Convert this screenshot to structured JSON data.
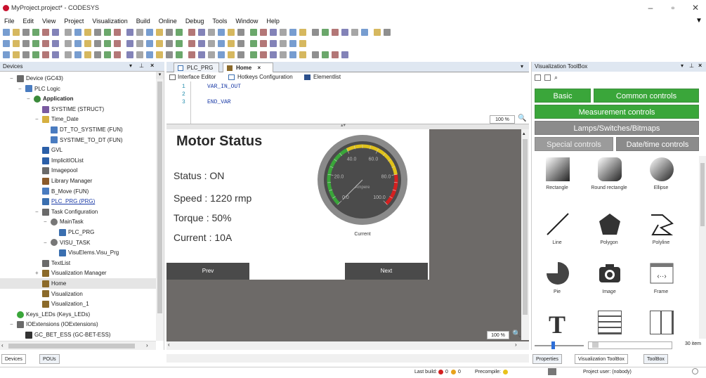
{
  "window": {
    "title": "MyProject.project* - CODESYS"
  },
  "menu": [
    "File",
    "Edit",
    "View",
    "Project",
    "Visualization",
    "Build",
    "Online",
    "Debug",
    "Tools",
    "Window",
    "Help"
  ],
  "devices_panel": {
    "title": "Devices",
    "tree": [
      {
        "label": "Device (GC43)",
        "depth": 1,
        "expand": "−",
        "icon": "device"
      },
      {
        "label": "PLC Logic",
        "depth": 2,
        "expand": "−",
        "icon": "plc"
      },
      {
        "label": "Application",
        "depth": 3,
        "expand": "−",
        "icon": "app",
        "bold": true
      },
      {
        "label": "SYSTIME (STRUCT)",
        "depth": 4,
        "expand": "",
        "icon": "struct"
      },
      {
        "label": "Time_Date",
        "depth": 4,
        "expand": "−",
        "icon": "folder"
      },
      {
        "label": "DT_TO_SYSTIME (FUN)",
        "depth": 5,
        "expand": "",
        "icon": "fun"
      },
      {
        "label": "SYSTIME_TO_DT (FUN)",
        "depth": 5,
        "expand": "",
        "icon": "fun"
      },
      {
        "label": "GVL",
        "depth": 4,
        "expand": "",
        "icon": "gvl"
      },
      {
        "label": "ImplicitIOList",
        "depth": 4,
        "expand": "",
        "icon": "gvl"
      },
      {
        "label": "Imagepool",
        "depth": 4,
        "expand": "",
        "icon": "image"
      },
      {
        "label": "Library Manager",
        "depth": 4,
        "expand": "",
        "icon": "lib"
      },
      {
        "label": "B_Move (FUN)",
        "depth": 4,
        "expand": "",
        "icon": "fun"
      },
      {
        "label": "PLC_PRG (PRG)",
        "depth": 4,
        "expand": "",
        "icon": "prg",
        "link": true
      },
      {
        "label": "Task Configuration",
        "depth": 4,
        "expand": "−",
        "icon": "task"
      },
      {
        "label": "MainTask",
        "depth": 5,
        "expand": "−",
        "icon": "gear"
      },
      {
        "label": "PLC_PRG",
        "depth": 6,
        "expand": "",
        "icon": "prg"
      },
      {
        "label": "VISU_TASK",
        "depth": 5,
        "expand": "−",
        "icon": "gear"
      },
      {
        "label": "VisuElems.Visu_Prg",
        "depth": 6,
        "expand": "",
        "icon": "prg"
      },
      {
        "label": "TextList",
        "depth": 4,
        "expand": "",
        "icon": "textlist"
      },
      {
        "label": "Visualization Manager",
        "depth": 4,
        "expand": "+",
        "icon": "vismgr"
      },
      {
        "label": "Home",
        "depth": 4,
        "expand": "",
        "icon": "visu",
        "selected": true
      },
      {
        "label": "Visualization",
        "depth": 4,
        "expand": "",
        "icon": "visu"
      },
      {
        "label": "Visualization_1",
        "depth": 4,
        "expand": "",
        "icon": "visu"
      },
      {
        "label": "Keys_LEDs (Keys_LEDs)",
        "depth": 1,
        "expand": "",
        "icon": "keys"
      },
      {
        "label": "IOExtensions (IOExtensions)",
        "depth": 1,
        "expand": "−",
        "icon": "io"
      },
      {
        "label": "GC_BET_ESS (GC-BET-ESS)",
        "depth": 2,
        "expand": "",
        "icon": "module"
      }
    ],
    "bottom_tabs": [
      "Devices",
      "POUs"
    ]
  },
  "editor": {
    "tabs": [
      {
        "label": "PLC_PRG",
        "active": false
      },
      {
        "label": "Home",
        "active": true
      }
    ],
    "subtabs": [
      "Interface Editor",
      "Hotkeys Configuration",
      "Elementlist"
    ],
    "code": [
      {
        "n": "1",
        "text": "VAR_IN_OUT"
      },
      {
        "n": "2",
        "text": ""
      },
      {
        "n": "3",
        "text": "END_VAR"
      }
    ],
    "zoom_top": "100 %",
    "zoom_bottom": "100 %"
  },
  "visu": {
    "title": "Motor Status",
    "status": "Status : ON",
    "speed": "Speed : 1220 rmp",
    "torque": "Torque : 50%",
    "current": "Current : 10A",
    "gauge": {
      "unit": "Ampere",
      "label": "Current",
      "ticks": [
        "0.0",
        "20.0",
        "40.0",
        "60.0",
        "80.0",
        "100.0"
      ],
      "min": 0,
      "max": 100,
      "value": 0
    },
    "prev": "Prev",
    "next": "Next"
  },
  "toolbox": {
    "title": "Visualization ToolBox",
    "categories": [
      "Basic",
      "Common controls",
      "Measurement controls",
      "Lamps/Switches/Bitmaps",
      "Special controls",
      "Date/time controls"
    ],
    "tools": [
      "Rectangle",
      "Round rectangle",
      "Ellipse",
      "Line",
      "Polygon",
      "Polyline",
      "Pie",
      "Image",
      "Frame"
    ],
    "item_count": "30 item",
    "bottom_tabs": [
      "Properties",
      "Visualization ToolBox",
      "ToolBox"
    ]
  },
  "statusbar": {
    "last_build": "Last build:",
    "errors": "0",
    "warnings": "0",
    "precompile": "Precompile:",
    "project_user": "Project user: (nobody)"
  },
  "colors": {
    "green": "#3aa63a",
    "gray_cat": "#8b8b8b",
    "visu_btn": "#4a4a4a",
    "canvas_bg": "#6d6a68"
  }
}
